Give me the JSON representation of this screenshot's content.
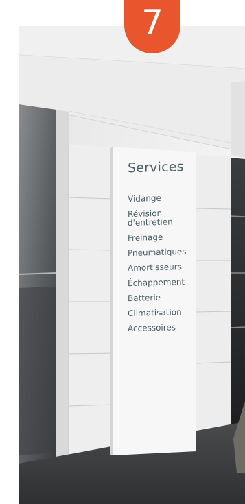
{
  "step_number": "7",
  "panel": {
    "title": "Services",
    "items": [
      "Vidange",
      "Révision\nd'entretien",
      "Freinage",
      "Pneumatiques",
      "Amortisseurs",
      "Échappement",
      "Batterie",
      "Climatisation",
      "Accessoires"
    ]
  },
  "colors": {
    "badge": "#e9552c",
    "panel_text": "#4b5f68",
    "floor": "#3a3b3d",
    "facade": "#ececec"
  }
}
